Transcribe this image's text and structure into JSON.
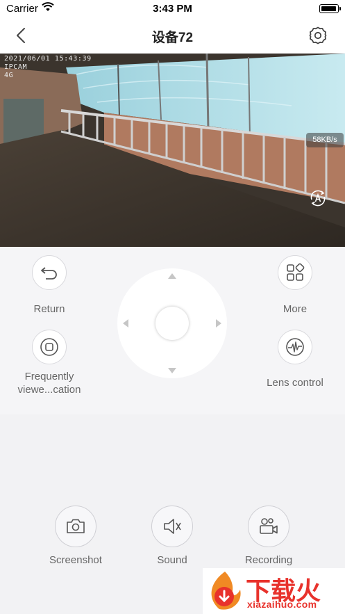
{
  "status_bar": {
    "carrier": "Carrier",
    "time": "3:43 PM"
  },
  "nav": {
    "title": "设备72"
  },
  "video": {
    "osd_lines": [
      "2021/06/01 15:43:39",
      "IPCAM",
      "4G"
    ],
    "bitrate": "58KB/s"
  },
  "controls": {
    "return_label": "Return",
    "frequently_viewed_label": "Frequently viewe...cation",
    "more_label": "More",
    "lens_control_label": "Lens control"
  },
  "bottom": {
    "screenshot_label": "Screenshot",
    "sound_label": "Sound",
    "recording_label": "Recording"
  },
  "watermark": {
    "text": "下载火",
    "url": "xiazaihuo.com"
  },
  "colors": {
    "accent": "#e8322c",
    "icon": "#555555"
  }
}
